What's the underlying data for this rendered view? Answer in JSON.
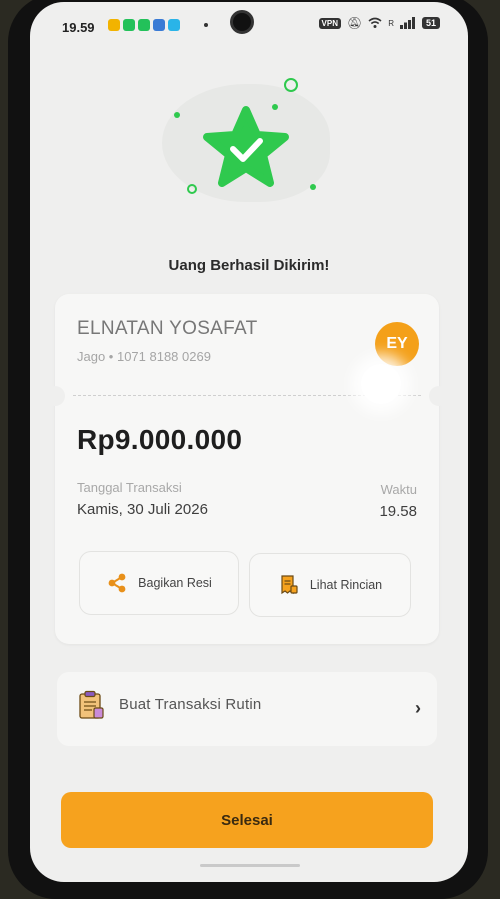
{
  "status_bar": {
    "time": "19.59",
    "app_icon_colors": [
      "#f2b300",
      "#23c15a",
      "#23c15a",
      "#3a7bd5",
      "#2ab4e8"
    ],
    "vpn": "VPN",
    "network": "R",
    "battery": "51"
  },
  "hero": {
    "title": "Uang Berhasil Dikirim!",
    "accent_color": "#2fc94e"
  },
  "transfer": {
    "recipient_name": "ELNATAN YOSAFAT",
    "recipient_account": "Jago • 1071 8188 0269",
    "avatar_initials": "EY",
    "avatar_color": "#f4a019",
    "amount": "Rp9.000.000",
    "date_label": "Tanggal Transaksi",
    "date_value": "Kamis, 30 Juli 2026",
    "time_label": "Waktu",
    "time_value": "19.58"
  },
  "actions": {
    "share_label": "Bagikan Resi",
    "share_icon": "share-icon",
    "detail_label": "Lihat Rincian",
    "detail_icon": "receipt-icon"
  },
  "routine": {
    "label": "Buat Transaksi Rutin",
    "icon": "clipboard-icon"
  },
  "done_button": {
    "label": "Selesai",
    "color": "#f6a21e"
  }
}
